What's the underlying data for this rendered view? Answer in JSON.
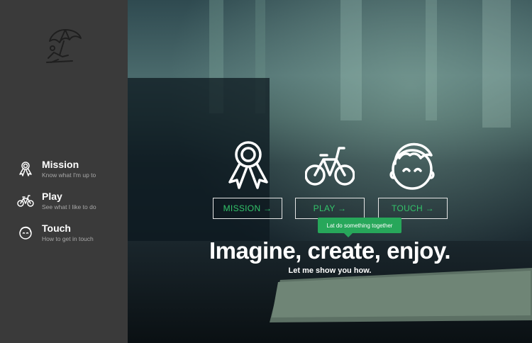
{
  "sidebar": {
    "logo_icon": "beach-umbrella-icon",
    "items": [
      {
        "title": "Mission",
        "subtitle": "Know what I'm up to",
        "icon": "ribbon-award-icon"
      },
      {
        "title": "Play",
        "subtitle": "See what I like to do",
        "icon": "bicycle-icon"
      },
      {
        "title": "Touch",
        "subtitle": "How to get in touch",
        "icon": "face-icon"
      }
    ]
  },
  "hero": {
    "buttons": [
      {
        "label": "MISSION →",
        "icon": "ribbon-award-icon"
      },
      {
        "label": "PLAY →",
        "icon": "bicycle-icon"
      },
      {
        "label": "TOUCH →",
        "icon": "face-icon"
      }
    ],
    "tooltip": "Lat do something together",
    "headline": "Imagine, create, enjoy.",
    "subline": "Let me show you how."
  },
  "colors": {
    "sidebar_bg": "#3a3a3a",
    "accent_green": "#33c46a",
    "tooltip_bg": "#27a75a"
  }
}
